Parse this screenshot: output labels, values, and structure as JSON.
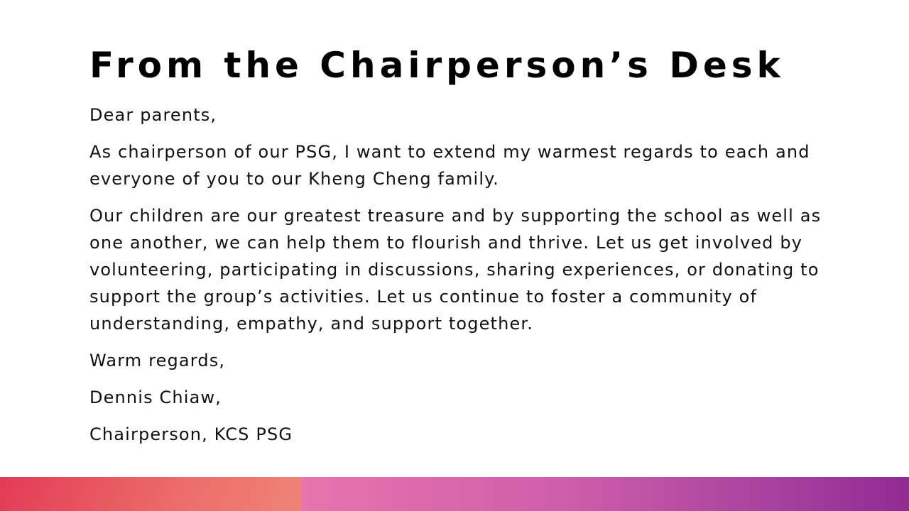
{
  "slide": {
    "title": "From the Chairperson’s Desk",
    "paragraphs": [
      "Dear parents,",
      "As chairperson of our PSG, I want to extend my warmest regards to each and everyone of you to our Kheng Cheng family.",
      "Our children are our greatest treasure and by supporting the school as well as one another, we can help them to flourish and thrive. Let us get involved by volunteering, participating in discussions, sharing experiences, or donating to support the group’s activities. Let us continue to foster a community of understanding, empathy, and support together.",
      "Warm regards,",
      "Dennis Chiaw,",
      "Chairperson, KCS PSG"
    ]
  },
  "colors": {
    "footer_left_start": "#e23b57",
    "footer_left_end": "#f08378",
    "footer_right_start": "#e874ae",
    "footer_right_end": "#922a92"
  }
}
